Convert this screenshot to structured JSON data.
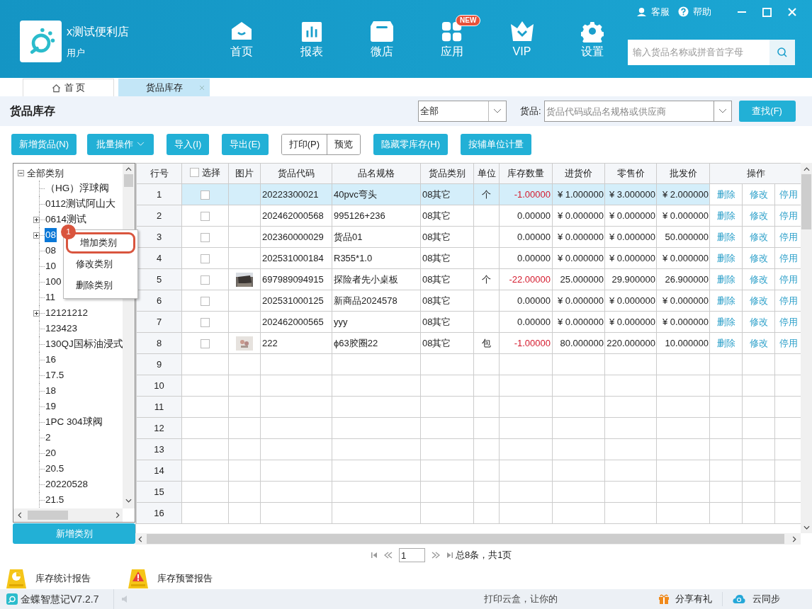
{
  "app": {
    "store_name": "x测试便利店",
    "user": "用户",
    "top_links": [
      "客服",
      "帮助"
    ],
    "search": {
      "placeholder": "输入货品名称或拼音首字母"
    }
  },
  "nav": [
    {
      "kind": "home",
      "label": "首页"
    },
    {
      "kind": "report",
      "label": "报表"
    },
    {
      "kind": "shop",
      "label": "微店"
    },
    {
      "kind": "apps",
      "label": "应用",
      "badge": "NEW"
    },
    {
      "kind": "vip",
      "label": "VIP"
    },
    {
      "kind": "settings",
      "label": "设置"
    }
  ],
  "tabs": [
    {
      "label": "首 页",
      "selected": false,
      "closable": false
    },
    {
      "label": "货品库存",
      "selected": true,
      "closable": true
    }
  ],
  "page_title": "货品库存",
  "filter": {
    "category": "全部",
    "goods_label": "货品:",
    "goods_placeholder": "货品代码或品名规格或供应商",
    "find": "查找(F)"
  },
  "toolbar": [
    {
      "kind": "button",
      "label": "新增货品(N)"
    },
    {
      "kind": "dropdown",
      "label": "批量操作"
    },
    {
      "kind": "button",
      "label": "导入(I)"
    },
    {
      "kind": "button",
      "label": "导出(E)"
    },
    {
      "kind": "outline",
      "label": "打印(P)"
    },
    {
      "kind": "outline",
      "label": "预览"
    },
    {
      "kind": "button",
      "label": "隐藏零库存(H)"
    },
    {
      "kind": "button",
      "label": "按辅单位计量"
    }
  ],
  "tree": {
    "label": "全部类别",
    "expanded": true,
    "children": [
      {
        "label": "（HG）浮球阀"
      },
      {
        "label": "0112测试阿山大"
      },
      {
        "label": "0614测试",
        "expanded": false
      },
      {
        "label": "08",
        "expanded": false,
        "selected": true
      },
      {
        "label": "08"
      },
      {
        "label": "10"
      },
      {
        "label": "100"
      },
      {
        "label": "11"
      },
      {
        "label": "12121212",
        "expanded": false
      },
      {
        "label": "123423"
      },
      {
        "label": "130QJ国标油浸式"
      },
      {
        "label": "16"
      },
      {
        "label": "17.5"
      },
      {
        "label": "18"
      },
      {
        "label": "19"
      },
      {
        "label": "1PC 304球阀"
      },
      {
        "label": "2"
      },
      {
        "label": "20"
      },
      {
        "label": "20.5"
      },
      {
        "label": "20220528"
      },
      {
        "label": "21.5"
      }
    ]
  },
  "context_menu": {
    "callout": "1",
    "items": [
      {
        "label": "增加类别",
        "highlighted": true
      },
      {
        "label": "修改类别",
        "highlighted": false
      },
      {
        "label": "删除类别",
        "highlighted": false
      }
    ]
  },
  "add_category": "新增类别",
  "table": {
    "select_all": false,
    "columns": [
      "行号",
      "选择",
      "图片",
      "货品代码",
      "品名规格",
      "货品类别",
      "单位",
      "库存数量",
      "进货价",
      "零售价",
      "批发价",
      "操作"
    ],
    "rows": [
      {
        "no": "1",
        "selected": true,
        "checked": false,
        "photo": false,
        "code": "20223300021",
        "name": "40pvc弯头",
        "category": "08其它",
        "unit": "个",
        "stock": "-1.00000",
        "negative": true,
        "cost": "¥ 1.000000",
        "retail": "¥ 3.000000",
        "wholesale": "¥ 2.000000",
        "actions": [
          "删除",
          "修改",
          "停用"
        ]
      },
      {
        "no": "2",
        "selected": false,
        "checked": false,
        "photo": false,
        "code": "202462000568",
        "name": "995126+236",
        "category": "08其它",
        "stock": "0.00000",
        "negative": false,
        "cost": "¥ 0.000000",
        "retail": "¥ 0.000000",
        "wholesale": "¥ 0.000000",
        "actions": [
          "删除",
          "修改",
          "停用"
        ]
      },
      {
        "no": "3",
        "selected": false,
        "checked": false,
        "photo": false,
        "code": "202360000029",
        "name": "货品01",
        "category": "08其它",
        "stock": "0.00000",
        "negative": false,
        "cost": "¥ 0.000000",
        "retail": "¥ 0.000000",
        "wholesale": "50.000000",
        "actions": [
          "删除",
          "修改",
          "停用"
        ]
      },
      {
        "no": "4",
        "selected": false,
        "checked": false,
        "photo": false,
        "code": "202531000184",
        "name": "R355*1.0",
        "category": "08其它",
        "stock": "0.00000",
        "negative": false,
        "cost": "¥ 0.000000",
        "retail": "¥ 0.000000",
        "wholesale": "¥ 0.000000",
        "actions": [
          "删除",
          "修改",
          "停用"
        ]
      },
      {
        "no": "5",
        "selected": false,
        "checked": false,
        "photo": true,
        "code": "697989094915",
        "name": "探险者先小桌板",
        "category": "08其它",
        "unit": "个",
        "stock": "-22.00000",
        "negative": true,
        "cost": "25.000000",
        "retail": "29.900000",
        "wholesale": "26.900000",
        "actions": [
          "删除",
          "修改",
          "停用"
        ]
      },
      {
        "no": "6",
        "selected": false,
        "checked": false,
        "photo": false,
        "code": "202531000125",
        "name": "新商品2024578",
        "category": "08其它",
        "stock": "0.00000",
        "negative": false,
        "cost": "¥ 0.000000",
        "retail": "¥ 0.000000",
        "wholesale": "¥ 0.000000",
        "actions": [
          "删除",
          "修改",
          "停用"
        ]
      },
      {
        "no": "7",
        "selected": false,
        "checked": false,
        "photo": false,
        "code": "202462000565",
        "name": "yyy",
        "category": "08其它",
        "stock": "0.00000",
        "negative": false,
        "cost": "¥ 0.000000",
        "retail": "¥ 0.000000",
        "wholesale": "¥ 0.000000",
        "actions": [
          "删除",
          "修改",
          "停用"
        ]
      },
      {
        "no": "8",
        "selected": false,
        "checked": false,
        "photo": true,
        "code": "222",
        "name": "ϕ63胶圈22",
        "category": "08其它",
        "unit": "包",
        "stock": "-1.00000",
        "negative": true,
        "cost": "80.000000",
        "retail": "220.000000",
        "wholesale": "10.000000",
        "actions": [
          "删除",
          "修改",
          "停用"
        ]
      }
    ],
    "blank_rows": [
      "9",
      "10",
      "11",
      "12",
      "13",
      "14",
      "15",
      "16"
    ]
  },
  "pagination": {
    "page": "1",
    "summary": "总8条，共1页"
  },
  "reports": [
    {
      "kind": "stats",
      "label": "库存统计报告"
    },
    {
      "kind": "warning",
      "label": "库存预警报告"
    }
  ],
  "status_bar": {
    "version": "金蝶智慧记V7.2.7",
    "ticker": "打印云盒，让你的",
    "share": "分享有礼",
    "sync": "云同步"
  }
}
